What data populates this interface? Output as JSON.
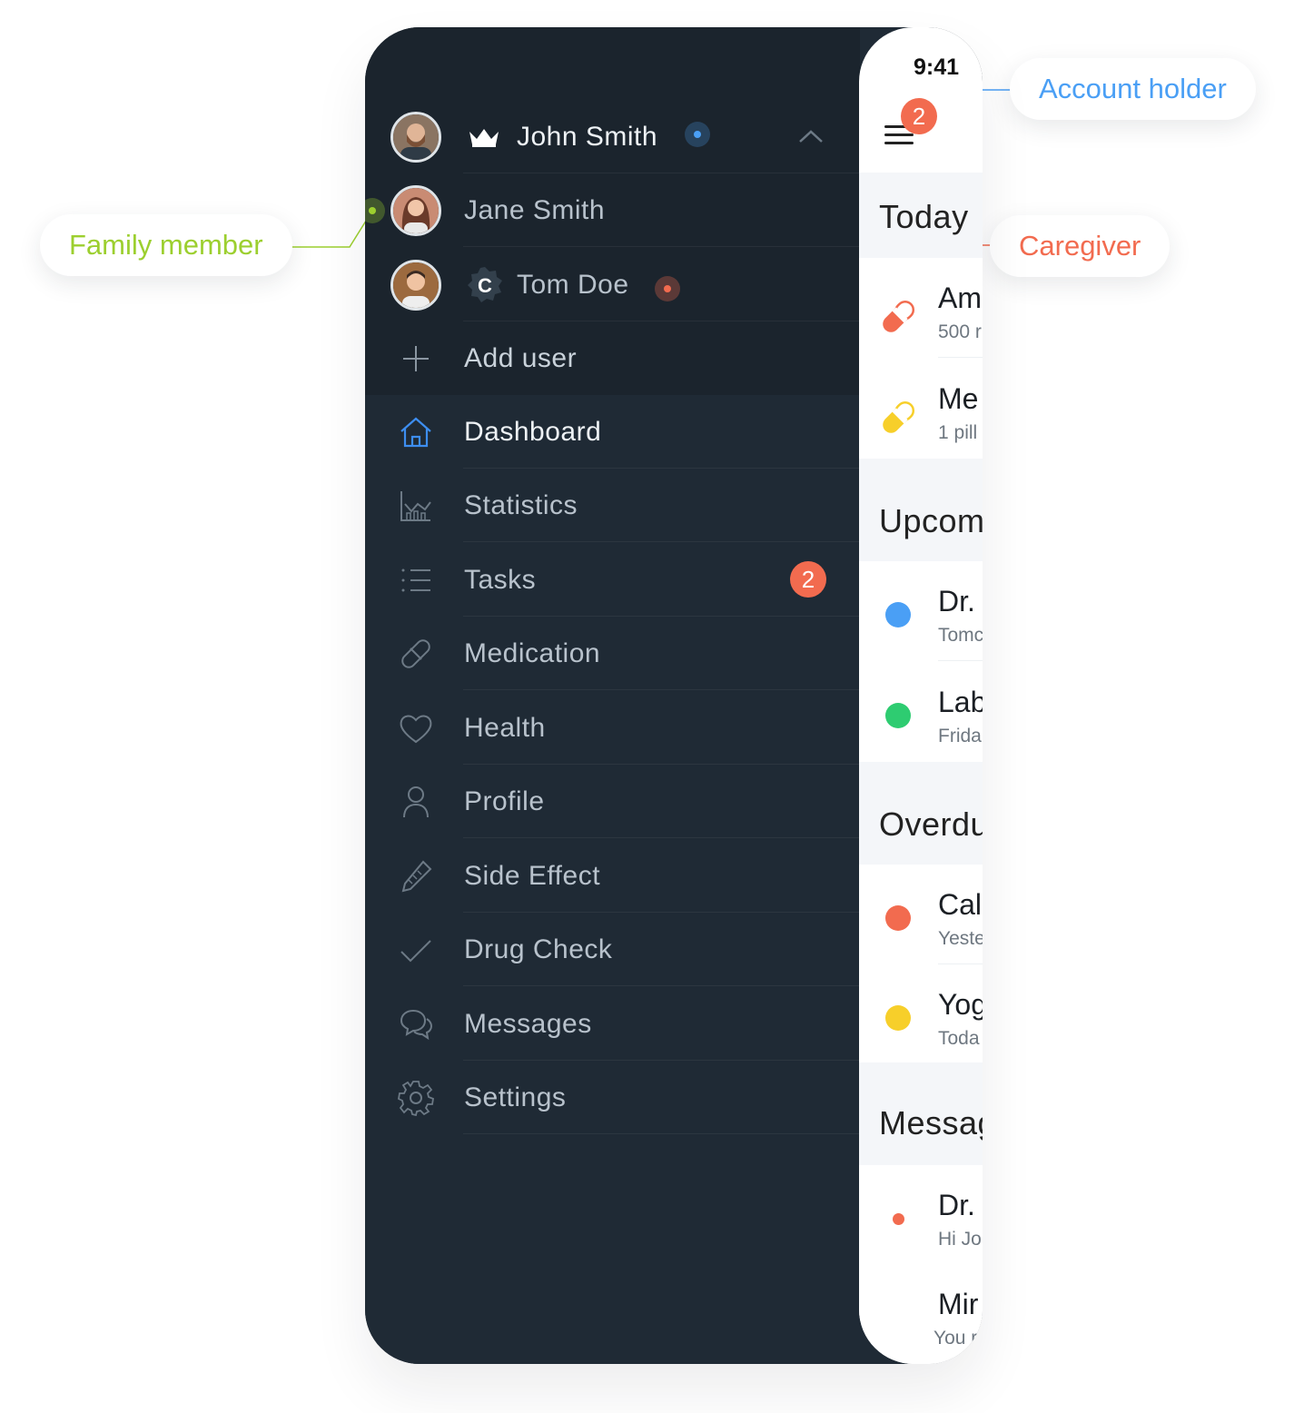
{
  "callouts": {
    "account_holder": "Account holder",
    "family_member": "Family member",
    "caregiver": "Caregiver"
  },
  "colors": {
    "account_blue": "#4a9ff5",
    "family_green": "#9ccf2f",
    "caregiver_orange": "#f26b4f",
    "drawer_bg": "#1f2a35",
    "accent_blue": "#3d8ef0"
  },
  "users": {
    "primary": {
      "name": "John Smith",
      "role_icon": "crown-icon"
    },
    "members": [
      {
        "name": "Jane Smith"
      },
      {
        "name": "Tom Doe",
        "badge": "C"
      }
    ],
    "add_label": "Add user"
  },
  "menu": [
    {
      "label": "Dashboard",
      "icon": "home-icon",
      "active": true
    },
    {
      "label": "Statistics",
      "icon": "statistics-icon"
    },
    {
      "label": "Tasks",
      "icon": "list-icon",
      "count": "2"
    },
    {
      "label": "Medication",
      "icon": "pill-icon"
    },
    {
      "label": "Health",
      "icon": "heart-icon"
    },
    {
      "label": "Profile",
      "icon": "user-icon"
    },
    {
      "label": "Side Effect",
      "icon": "thermometer-icon"
    },
    {
      "label": "Drug Check",
      "icon": "check-icon"
    },
    {
      "label": "Messages",
      "icon": "chat-icon"
    },
    {
      "label": "Settings",
      "icon": "gear-icon"
    }
  ],
  "panel": {
    "time": "9:41",
    "menu_badge": "2",
    "sections": {
      "today": "Today",
      "upcoming": "Upcom",
      "overdue": "Overdu",
      "messages": "Messag"
    },
    "today_items": [
      {
        "title": "Am",
        "sub": "500 r"
      },
      {
        "title": "Me",
        "sub": "1 pill"
      }
    ],
    "upcoming_items": [
      {
        "title": "Dr.",
        "sub": "Tomc"
      },
      {
        "title": "Lab",
        "sub": "Frida"
      }
    ],
    "overdue_items": [
      {
        "title": "Cal",
        "sub": "Yeste"
      },
      {
        "title": "Yog",
        "sub": "Toda"
      }
    ],
    "message_items": [
      {
        "title": "Dr.",
        "sub": "Hi Jo"
      },
      {
        "title": "Mir",
        "sub": "You r"
      }
    ]
  }
}
